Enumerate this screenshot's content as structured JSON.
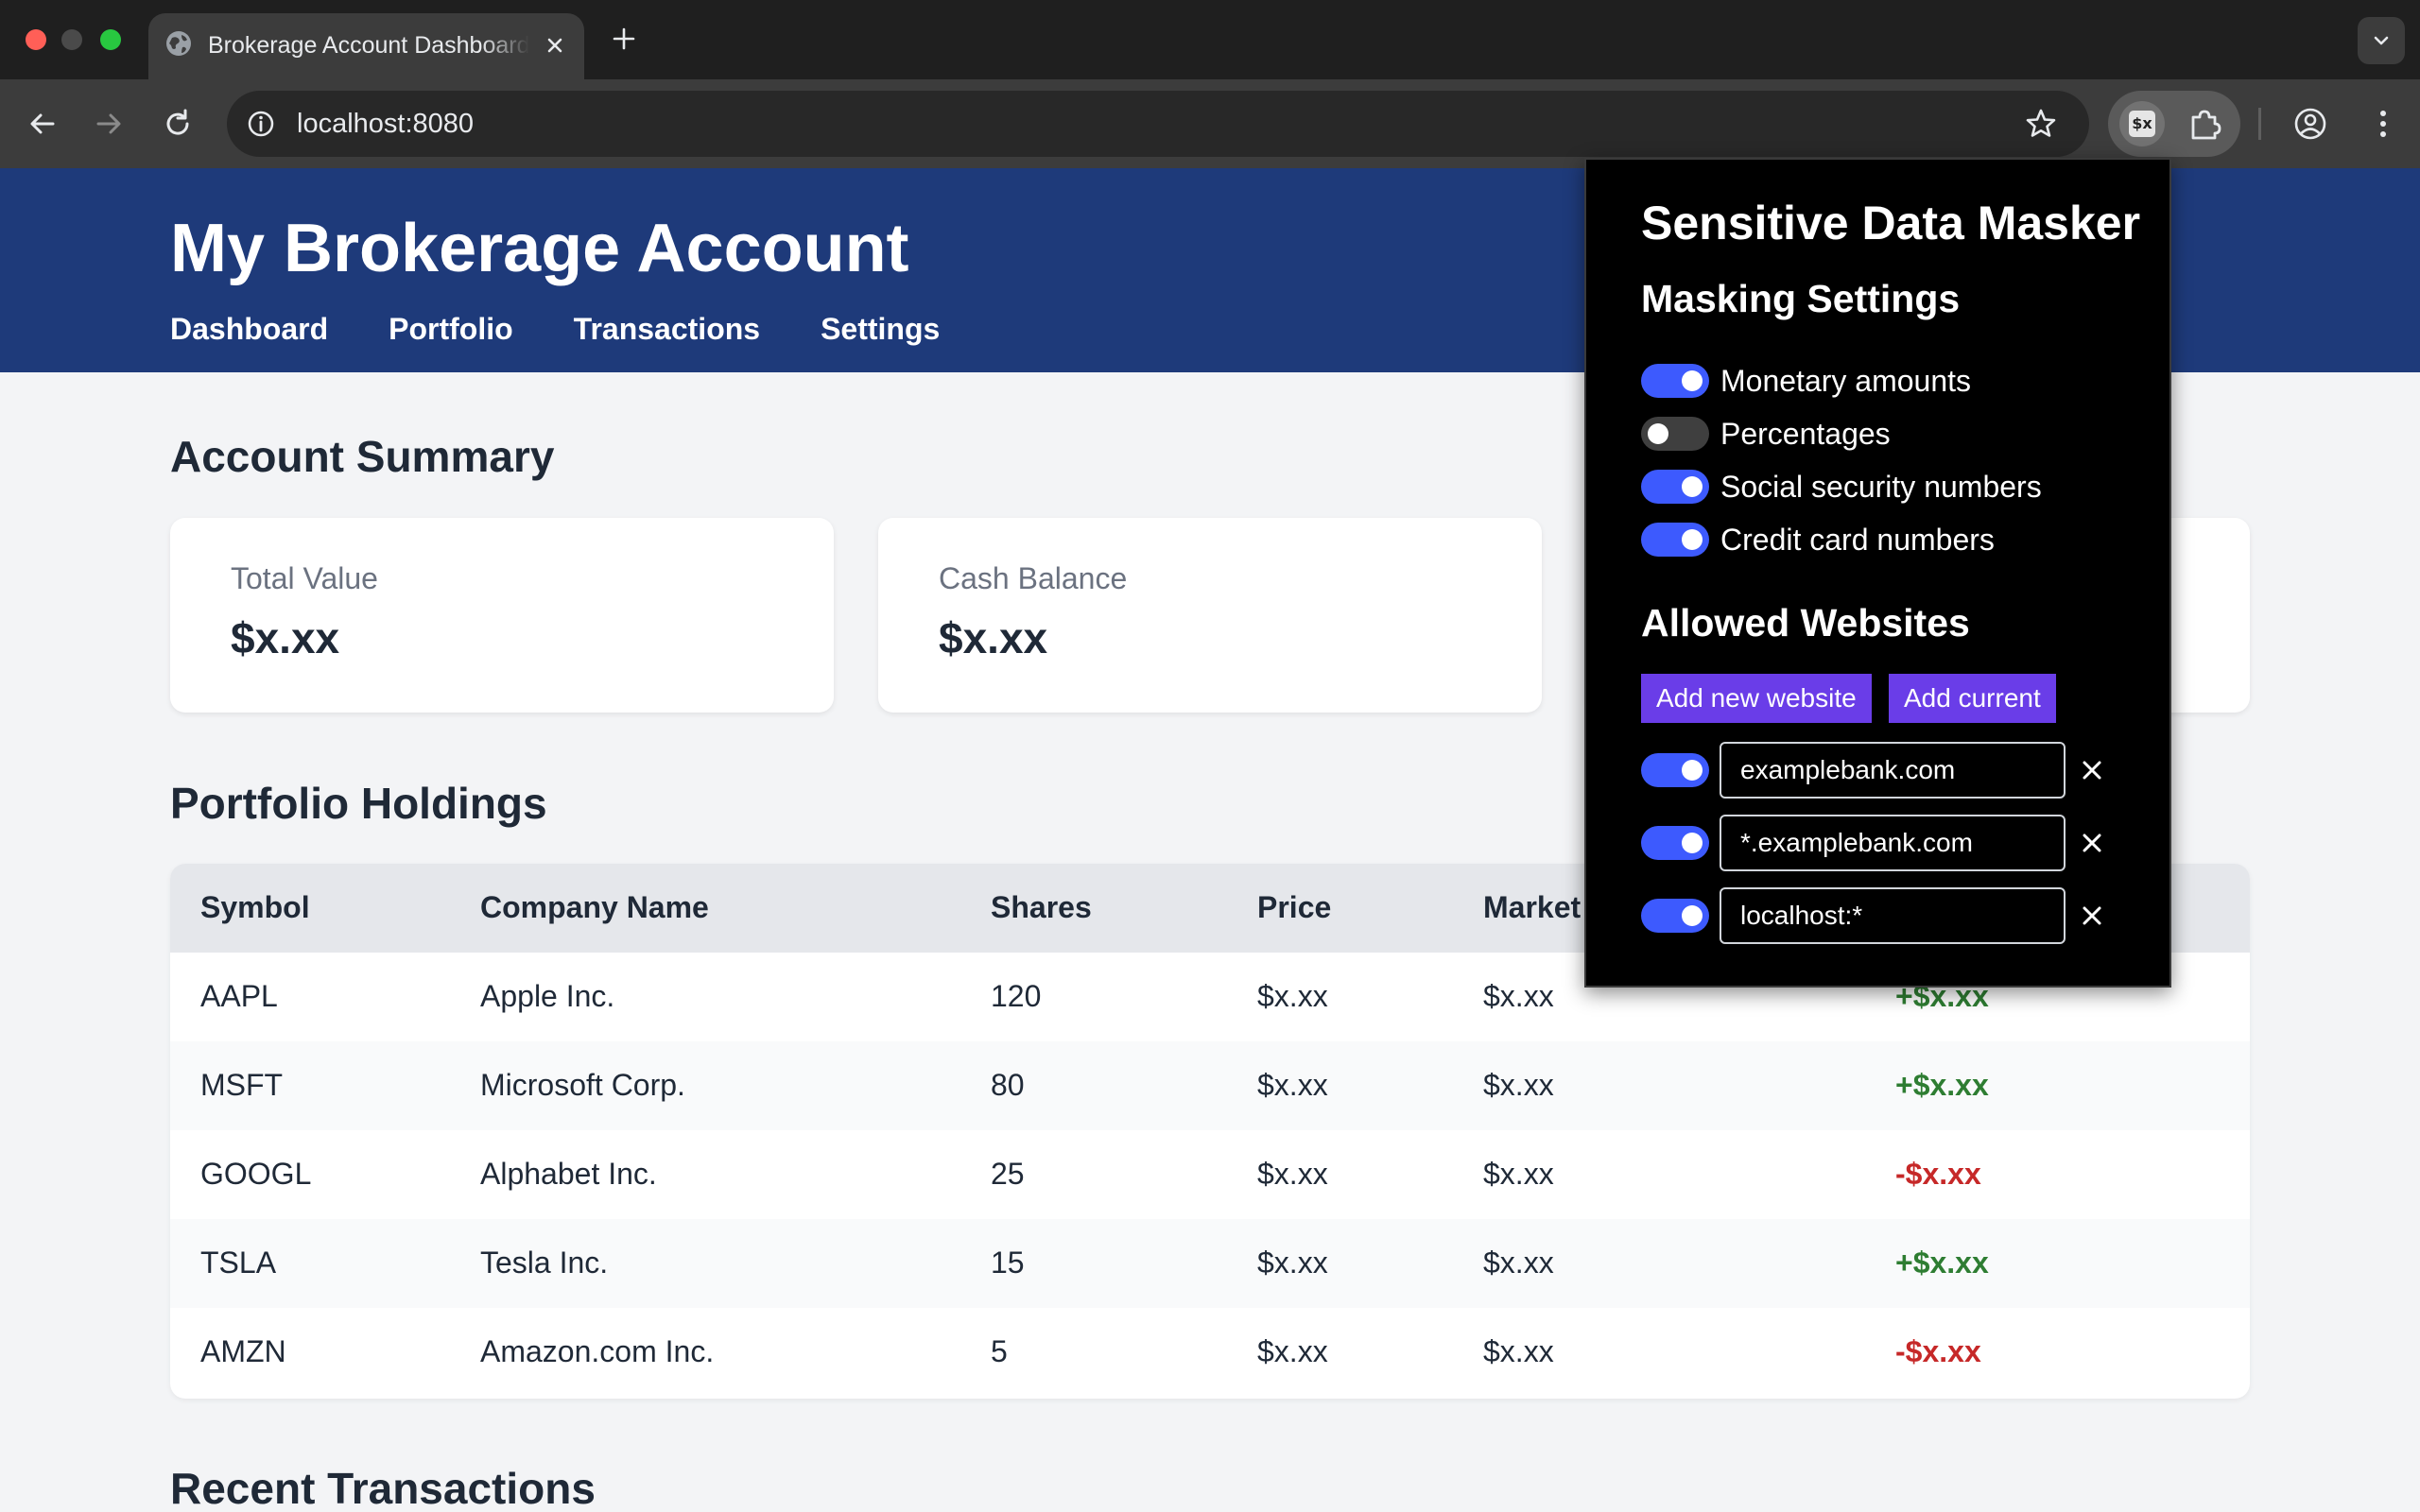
{
  "browser": {
    "tab_title": "Brokerage Account Dashboard",
    "url": "localhost:8080",
    "extension_icon_text": "$x"
  },
  "site": {
    "title": "My Brokerage Account",
    "nav": [
      "Dashboard",
      "Portfolio",
      "Transactions",
      "Settings"
    ]
  },
  "summary": {
    "title": "Account Summary",
    "cards": [
      {
        "label": "Total Value",
        "value": "$x.xx"
      },
      {
        "label": "Cash Balance",
        "value": "$x.xx"
      }
    ]
  },
  "holdings": {
    "title": "Portfolio Holdings",
    "columns": [
      "Symbol",
      "Company Name",
      "Shares",
      "Price",
      "Market"
    ],
    "rows": [
      {
        "symbol": "AAPL",
        "company": "Apple Inc.",
        "shares": "120",
        "price": "$x.xx",
        "market": "$x.xx",
        "gain": "+$x.xx",
        "gain_color": "#2e7d32"
      },
      {
        "symbol": "MSFT",
        "company": "Microsoft Corp.",
        "shares": "80",
        "price": "$x.xx",
        "market": "$x.xx",
        "gain": "+$x.xx",
        "gain_color": "#2e7d32"
      },
      {
        "symbol": "GOOGL",
        "company": "Alphabet Inc.",
        "shares": "25",
        "price": "$x.xx",
        "market": "$x.xx",
        "gain": "-$x.xx",
        "gain_color": "#c62828"
      },
      {
        "symbol": "TSLA",
        "company": "Tesla Inc.",
        "shares": "15",
        "price": "$x.xx",
        "market": "$x.xx",
        "gain": "+$x.xx",
        "gain_color": "#2e7d32"
      },
      {
        "symbol": "AMZN",
        "company": "Amazon.com Inc.",
        "shares": "5",
        "price": "$x.xx",
        "market": "$x.xx",
        "gain": "-$x.xx",
        "gain_color": "#c62828"
      }
    ]
  },
  "transactions": {
    "title": "Recent Transactions"
  },
  "popup": {
    "title": "Sensitive Data Masker",
    "masking_title": "Masking Settings",
    "settings": [
      {
        "label": "Monetary amounts",
        "enabled": true
      },
      {
        "label": "Percentages",
        "enabled": false
      },
      {
        "label": "Social security numbers",
        "enabled": true
      },
      {
        "label": "Credit card numbers",
        "enabled": true
      }
    ],
    "allowed_title": "Allowed Websites",
    "add_new_label": "Add new website",
    "add_current_label": "Add current",
    "sites": [
      {
        "value": "examplebank.com",
        "enabled": true
      },
      {
        "value": "*.examplebank.com",
        "enabled": true
      },
      {
        "value": "localhost:*",
        "enabled": true
      }
    ]
  },
  "colors": {
    "header_bg": "#1e3a7a",
    "toggle_on": "#3d5afe",
    "toggle_off": "#3f3f3f",
    "button_purple": "#6a3de8",
    "gain_positive": "#2e7d32",
    "gain_negative": "#c62828"
  }
}
